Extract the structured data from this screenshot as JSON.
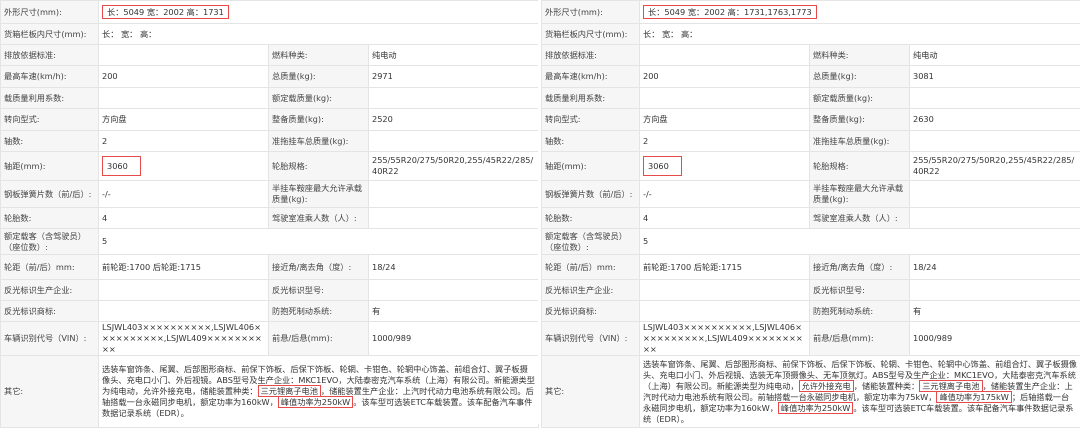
{
  "panels": [
    {
      "rows": [
        [
          {
            "label": "外形尺寸(mm):",
            "value": "长：5049 宽：2002 高：1731"
          }
        ],
        [
          {
            "label": "货箱栏板内尺寸(mm):",
            "value": "长： 宽： 高："
          }
        ],
        [
          {
            "label": "排放依据标准:",
            "value": ""
          },
          {
            "label": "燃料种类:",
            "value": "纯电动"
          }
        ],
        [
          {
            "label": "最高车速(km/h):",
            "value": "200"
          },
          {
            "label": "总质量(kg):",
            "value": "2971"
          }
        ],
        [
          {
            "label": "载质量利用系数:",
            "value": ""
          },
          {
            "label": "额定载质量(kg):",
            "value": ""
          }
        ],
        [
          {
            "label": "转向型式:",
            "value": "方向盘"
          },
          {
            "label": "整备质量(kg):",
            "value": "2520"
          }
        ],
        [
          {
            "label": "轴数:",
            "value": "2"
          },
          {
            "label": "准拖挂车总质量(kg):",
            "value": ""
          }
        ],
        [
          {
            "label": "轴距(mm):",
            "value": "3060"
          },
          {
            "label": "轮胎规格:",
            "value": "255/55R20/275/50R20,255/45R22/285/40R22"
          }
        ],
        [
          {
            "label": "钢板弹簧片数（前/后）:",
            "value": "-/-"
          },
          {
            "label": "半挂车鞍座最大允许承载质量(kg):",
            "value": ""
          }
        ],
        [
          {
            "label": "轮胎数:",
            "value": "4"
          },
          {
            "label": "驾驶室准乘人数（人）:",
            "value": ""
          }
        ],
        [
          {
            "label": "额定载客（含驾驶员）（座位数）:",
            "value": "5"
          }
        ],
        [
          {
            "label": "轮距（前/后）mm:",
            "value": "前轮距:1700 后轮距:1715"
          },
          {
            "label": "接近角/离去角（度）:",
            "value": "18/24"
          }
        ],
        [
          {
            "label": "反光标识生产企业:",
            "value": ""
          },
          {
            "label": "反光标识型号:",
            "value": ""
          }
        ],
        [
          {
            "label": "反光标识商标:",
            "value": ""
          },
          {
            "label": "防抱死制动系统:",
            "value": "有"
          }
        ],
        [
          {
            "label": "车辆识别代号（VIN）:",
            "value": "LSJWL403××××××××××,LSJWL406××××××××××,LSJWL409××××××××××"
          },
          {
            "label": "前悬/后悬(mm):",
            "value": "1000/989"
          }
        ]
      ],
      "other": {
        "label": "其它:",
        "parts": [
          {
            "t": "选装车窗饰条、尾翼、后部图形商标、前保下饰板、后保下饰板、轮辋、卡钳色、轮辋中心饰盖、前组合灯、翼子板摄像头、充电口小门、外后视镜。ABS型号及生产企业：MKC1EVO，大陆泰密克汽车系统（上海）有限公司。新能源类型为纯电动，允许外接充电，储能装置种类："
          },
          {
            "t": "三元锂离子电池",
            "hl": true
          },
          {
            "t": "，储能装置生产企业：上汽时代动力电池系统有限公司。后轴搭载一台永磁同步电机，额定功率为160kW，"
          },
          {
            "t": "峰值功率为250kW",
            "hl": true
          },
          {
            "t": "。该车型可选装ETC车载装置。该车配备汽车事件数据记录系统（EDR）。"
          }
        ]
      }
    },
    {
      "rows": [
        [
          {
            "label": "外形尺寸(mm):",
            "value": "长：5049 宽：2002 高：1731,1763,1773"
          }
        ],
        [
          {
            "label": "货箱栏板内尺寸(mm):",
            "value": "长： 宽： 高："
          }
        ],
        [
          {
            "label": "排放依据标准:",
            "value": ""
          },
          {
            "label": "燃料种类:",
            "value": "纯电动"
          }
        ],
        [
          {
            "label": "最高车速(km/h):",
            "value": "200"
          },
          {
            "label": "总质量(kg):",
            "value": "3081"
          }
        ],
        [
          {
            "label": "载质量利用系数:",
            "value": ""
          },
          {
            "label": "额定载质量(kg):",
            "value": ""
          }
        ],
        [
          {
            "label": "转向型式:",
            "value": "方向盘"
          },
          {
            "label": "整备质量(kg):",
            "value": "2630"
          }
        ],
        [
          {
            "label": "轴数:",
            "value": "2"
          },
          {
            "label": "准拖挂车总质量(kg):",
            "value": ""
          }
        ],
        [
          {
            "label": "轴距(mm):",
            "value": "3060"
          },
          {
            "label": "轮胎规格:",
            "value": "255/55R20/275/50R20,255/45R22/285/40R22"
          }
        ],
        [
          {
            "label": "钢板弹簧片数（前/后）:",
            "value": "-/-"
          },
          {
            "label": "半挂车鞍座最大允许承载质量(kg):",
            "value": ""
          }
        ],
        [
          {
            "label": "轮胎数:",
            "value": "4"
          },
          {
            "label": "驾驶室准乘人数（人）:",
            "value": ""
          }
        ],
        [
          {
            "label": "额定载客（含驾驶员）（座位数）:",
            "value": "5"
          }
        ],
        [
          {
            "label": "轮距（前/后）mm:",
            "value": "前轮距:1700 后轮距:1715"
          },
          {
            "label": "接近角/离去角（度）:",
            "value": "18/24"
          }
        ],
        [
          {
            "label": "反光标识生产企业:",
            "value": ""
          },
          {
            "label": "反光标识型号:",
            "value": ""
          }
        ],
        [
          {
            "label": "反光标识商标:",
            "value": ""
          },
          {
            "label": "防抱死制动系统:",
            "value": "有"
          }
        ],
        [
          {
            "label": "车辆识别代号（VIN）:",
            "value": "LSJWL403××××××××××,LSJWL406××××××××××,LSJWL409××××××××××"
          },
          {
            "label": "前悬/后悬(mm):",
            "value": "1000/989"
          }
        ]
      ],
      "other": {
        "label": "其它:",
        "parts": [
          {
            "t": "选装车窗饰条、尾翼、后部图形商标、前保下饰板、后保下饰板、轮辋、卡钳色、轮辋中心饰盖、前组合灯、翼子板摄像头、充电口小门、外后视镜、选装无车顶摄像头、无车顶氛灯。ABS型号及生产企业：MKC1EVO，大陆泰密克汽车系统（上海）有限公司。新能源类型为纯电动，"
          },
          {
            "t": "允许外接充电",
            "hl": true
          },
          {
            "t": "，储能装置种类："
          },
          {
            "t": "三元锂离子电池",
            "hl": true
          },
          {
            "t": "，储能装置生产企业：上汽时代动力电池系统有限公司。前轴搭载一台永磁同步电机，额定功率为75kW，"
          },
          {
            "t": "峰值功率为175kW",
            "hl": true
          },
          {
            "t": "；后轴搭载一台永磁同步电机，额定功率为160kW，"
          },
          {
            "t": "峰值功率为250kW",
            "hl": true
          },
          {
            "t": "。该车型可选装ETC车载装置。该车配备汽车事件数据记录系统（EDR）。"
          }
        ]
      }
    }
  ]
}
